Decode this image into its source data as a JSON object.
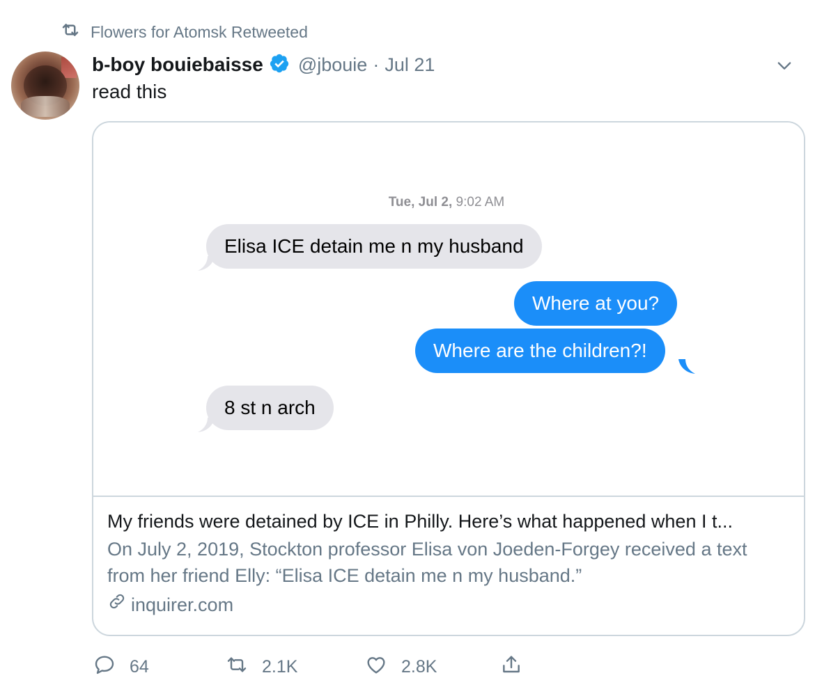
{
  "retweet_context": {
    "text": "Flowers for Atomsk Retweeted",
    "icon": "retweet-icon"
  },
  "author": {
    "display_name": "b-boy bouiebaisse",
    "handle": "@jbouie",
    "separator": "·",
    "date": "Jul 21",
    "verified": true
  },
  "tweet": {
    "text": "read this"
  },
  "card": {
    "media": {
      "timestamp_day": "Tue, Jul 2,",
      "timestamp_time": "9:02 AM",
      "messages": [
        {
          "direction": "incoming",
          "text": "Elisa ICE detain me n my husband"
        },
        {
          "direction": "outgoing",
          "text": "Where at you?"
        },
        {
          "direction": "outgoing",
          "text": "Where are the children?!"
        },
        {
          "direction": "incoming",
          "text": "8 st n arch"
        }
      ]
    },
    "title": "My friends were detained by ICE in Philly. Here’s what happened when I t...",
    "description_line1": "On July 2, 2019, Stockton professor Elisa von Joeden-Forgey received a text",
    "description_line2": "from her friend Elly: “Elisa ICE detain me n my husband.”",
    "domain": "inquirer.com"
  },
  "actions": {
    "replies": "64",
    "retweets": "2.1K",
    "likes": "2.8K"
  },
  "colors": {
    "verified_blue": "#1da1f2",
    "imessage_blue": "#1b8ef9",
    "imessage_gray": "#e5e5ea",
    "secondary_text": "#657786"
  }
}
